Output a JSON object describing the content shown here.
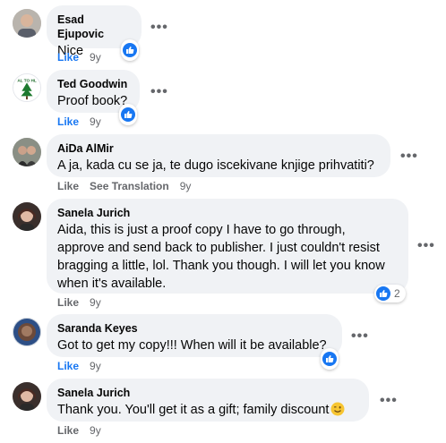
{
  "comments": [
    {
      "author": "Esad Ejupovic",
      "text": "Nice",
      "like": "Like",
      "time": "9y",
      "more": "•••"
    },
    {
      "author": "Ted Goodwin",
      "text": "Proof book?",
      "like": "Like",
      "time": "9y",
      "more": "•••"
    },
    {
      "author": "AiDa AlMir",
      "text": "A ja, kada cu se ja, te dugo iscekivane knjige prihvatiti?",
      "like": "Like",
      "translate": "See Translation",
      "time": "9y",
      "more": "•••"
    },
    {
      "author": "Sanela Jurich",
      "lines": [
        "Aida, this is just a proof copy I have to go through,",
        "approve and send back to publisher. I just couldn't resist",
        "bragging a little, lol. Thank you though. I will let you know",
        "when it's available."
      ],
      "like": "Like",
      "time": "9y",
      "more": "•••",
      "reaction_count": "2"
    },
    {
      "author": "Saranda Keyes",
      "text": "Got to get my copy!!! When will it be available?",
      "like": "Like",
      "time": "9y",
      "more": "•••"
    },
    {
      "author": "Sanela Jurich",
      "text": "Thank you. You'll get it as a gift; family discount",
      "like": "Like",
      "time": "9y",
      "more": "•••",
      "emoji": "winking-face-emoji"
    }
  ],
  "colors": {
    "bubble": "#f0f2f5",
    "like_blue": "#1877f2",
    "meta_gray": "#65676b"
  }
}
